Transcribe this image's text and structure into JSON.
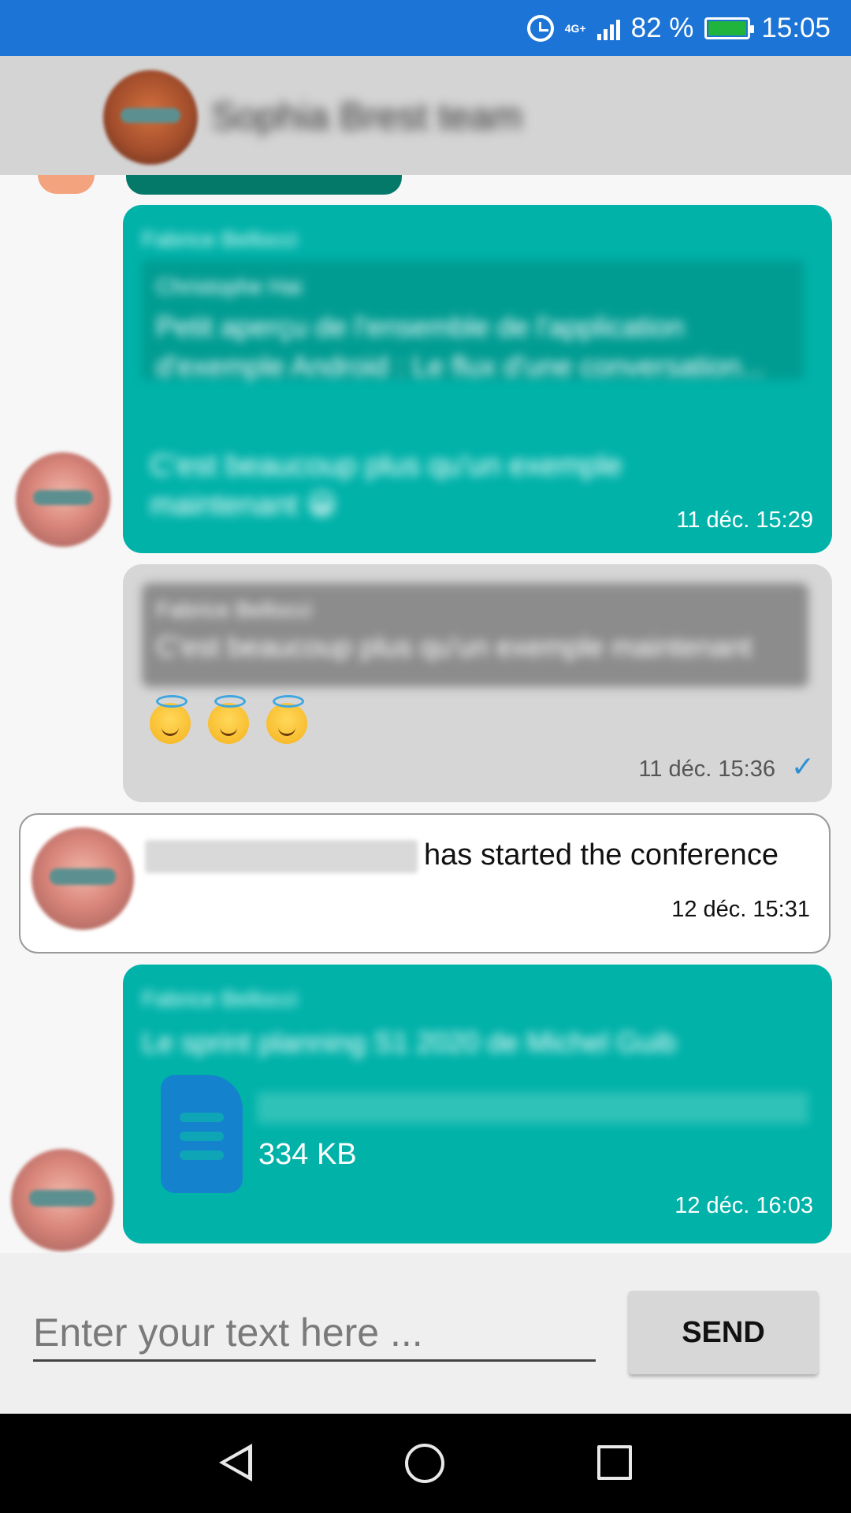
{
  "status_bar": {
    "network": "4G+",
    "battery": "82 %",
    "time": "15:05",
    "icons": [
      "alarm-icon",
      "signal-icon",
      "battery-icon"
    ]
  },
  "header": {
    "title": "Sophia Brest team"
  },
  "messages": [
    {
      "author": "Fabrice Bellocci",
      "quote_author": "Christophe Hai",
      "quote_text": "Petit aperçu de l'ensemble de l'application d'exemple Android : Le flux d'une conversation...",
      "text": "C'est beaucoup plus qu'un exemple maintenant 😀",
      "timestamp": "11 déc. 15:29"
    },
    {
      "quote_author": "Fabrice Bellocci",
      "quote_text": "C'est beaucoup plus qu'un exemple maintenant",
      "text": "😇 😇 😇",
      "timestamp": "11 déc. 15:36"
    },
    {
      "author_blurred": "Fabrice Bellocci",
      "text": "has started the conference",
      "timestamp": "12 déc. 15:31"
    },
    {
      "author": "Fabrice Bellocci",
      "text": "Le sprint planning S1 2020 de Michel Guib",
      "file_name": "Rainbow Sprint Planning 2020S1 v0...",
      "file_size": "334 KB",
      "timestamp": "12 déc. 16:03"
    }
  ],
  "composer": {
    "placeholder": "Enter your text here ...",
    "send_label": "SEND"
  },
  "colors": {
    "status_bar": "#1c74d6",
    "bubble_teal": "#01b2a9",
    "bubble_grey": "#d6d6d6",
    "read_check": "#2d8fd5"
  }
}
